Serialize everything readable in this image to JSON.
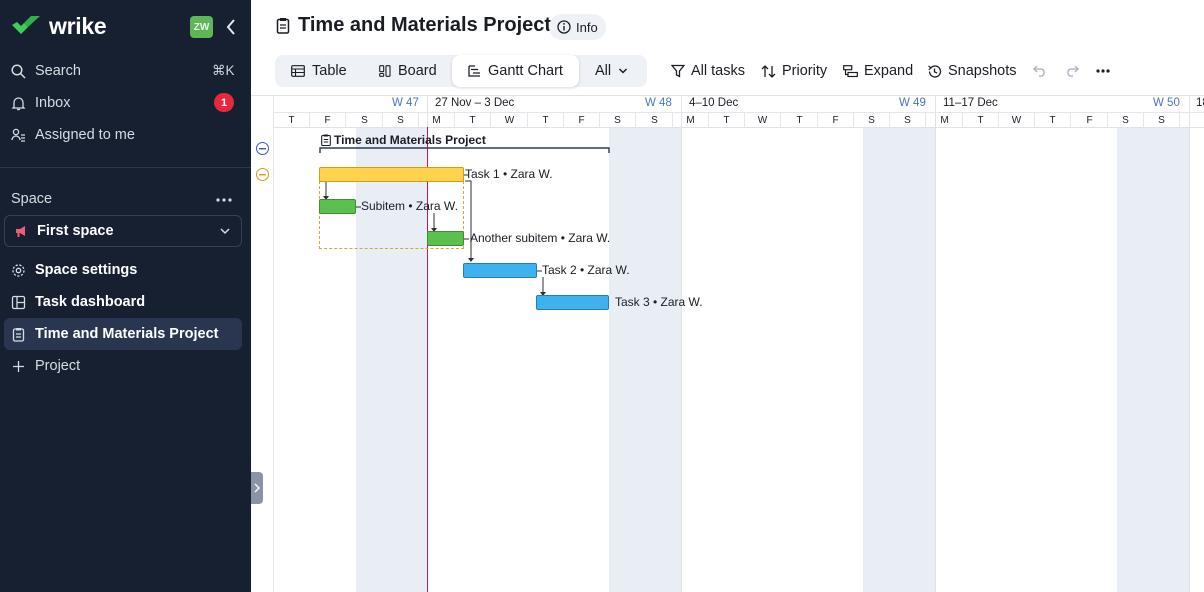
{
  "app": {
    "logo_text": "wrike",
    "avatar_initials": "ZW"
  },
  "sidebar": {
    "search_label": "Search",
    "search_shortcut": "⌘K",
    "inbox_label": "Inbox",
    "inbox_badge": "1",
    "assigned_label": "Assigned to me",
    "space_section_label": "Space",
    "space_selected": "First space",
    "items": [
      {
        "label": "Space settings",
        "icon": "gear-icon"
      },
      {
        "label": "Task dashboard",
        "icon": "dashboard-icon"
      },
      {
        "label": "Time and Materials Project",
        "icon": "clipboard-icon",
        "active": true
      },
      {
        "label": "Project",
        "icon": "plus-icon"
      }
    ]
  },
  "header": {
    "title": "Time and Materials Project",
    "info_label": "Info"
  },
  "views": {
    "tabs": [
      {
        "label": "Table",
        "icon": "table-icon"
      },
      {
        "label": "Board",
        "icon": "board-icon"
      },
      {
        "label": "Gantt Chart",
        "icon": "gantt-icon",
        "active": true
      },
      {
        "label": "All",
        "icon": "chevron-down-icon"
      }
    ]
  },
  "toolbar": {
    "filter_label": "All tasks",
    "sort_label": "Priority",
    "expand_label": "Expand",
    "snapshots_label": "Snapshots"
  },
  "gantt": {
    "week_labels": [
      "W 47",
      "W 48",
      "W 49",
      "W 50"
    ],
    "range_labels": [
      "27 Nov – 3 Dec",
      "4–10 Dec",
      "11–17 Dec",
      "18"
    ],
    "day_letters": [
      "T",
      "F",
      "S",
      "S",
      "M",
      "T",
      "W",
      "T",
      "F",
      "S",
      "S",
      "M",
      "T",
      "W",
      "T",
      "F",
      "S",
      "S",
      "M",
      "T",
      "W",
      "T",
      "F",
      "S",
      "S",
      "M"
    ],
    "project_label": "Time and Materials Project",
    "rows": [
      {
        "label": "Task 1 • Zara W.",
        "color": "#ffd34d",
        "type": "parent"
      },
      {
        "label": "Subitem • Zara W.",
        "color": "#5cbf4f",
        "type": "subtask"
      },
      {
        "label": "Another subitem • Zara W.",
        "color": "#5cbf4f",
        "type": "subtask"
      },
      {
        "label": "Task 2 • Zara W.",
        "color": "#3fb1ec",
        "type": "task"
      },
      {
        "label": "Task 3 • Zara W.",
        "color": "#3fb1ec",
        "type": "task"
      }
    ]
  },
  "colors": {
    "sidebar_bg": "#162031",
    "accent_green": "#5cbf4f",
    "accent_yellow": "#ffd34d",
    "accent_blue": "#3fb1ec",
    "today_line": "#c2185b",
    "badge_red": "#e8283b"
  }
}
